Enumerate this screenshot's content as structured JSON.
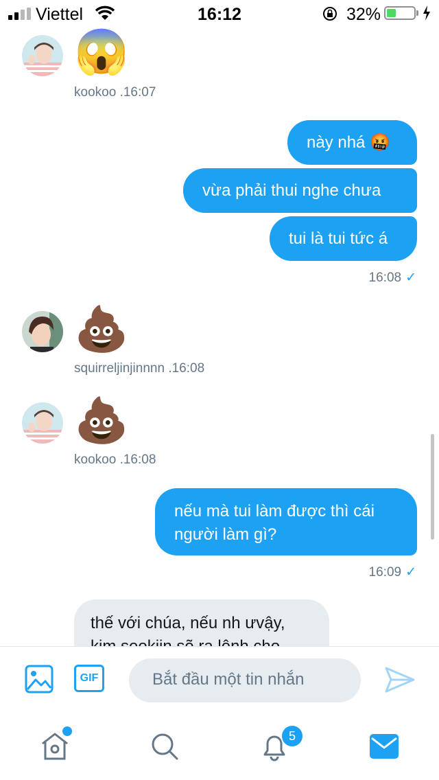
{
  "status_bar": {
    "carrier": "Viettel",
    "time": "16:12",
    "battery_percent": "32%",
    "battery_level": 0.32
  },
  "messages": [
    {
      "type": "incoming_emoji",
      "emoji": "😱",
      "sender": "kookoo",
      "time": "16:07"
    },
    {
      "type": "outgoing",
      "texts": [
        "này nhá 🤬",
        "vừa phải thui nghe chưa",
        "tui là tui tức á"
      ],
      "time": "16:08"
    },
    {
      "type": "incoming_emoji",
      "emoji": "💩",
      "sender": "squirreljinjinnnn",
      "time": "16:08"
    },
    {
      "type": "incoming_emoji",
      "emoji": "💩",
      "sender": "kookoo",
      "time": "16:08"
    },
    {
      "type": "outgoing",
      "texts": [
        "nếu mà tui làm được thì cái người làm gì?"
      ],
      "time": "16:09"
    },
    {
      "type": "incoming",
      "texts": [
        "thế với chúa, nếu nh ưvậy, kim seokjin sẽ ra lệnh cho"
      ]
    }
  ],
  "composer": {
    "placeholder": "Bắt đầu một tin nhắn",
    "gif_label": "GIF"
  },
  "tabbar": {
    "notifications_badge": "5"
  },
  "colors": {
    "accent": "#1da1f2",
    "incoming_bubble": "#e6ecf0",
    "meta_text": "#657786"
  }
}
